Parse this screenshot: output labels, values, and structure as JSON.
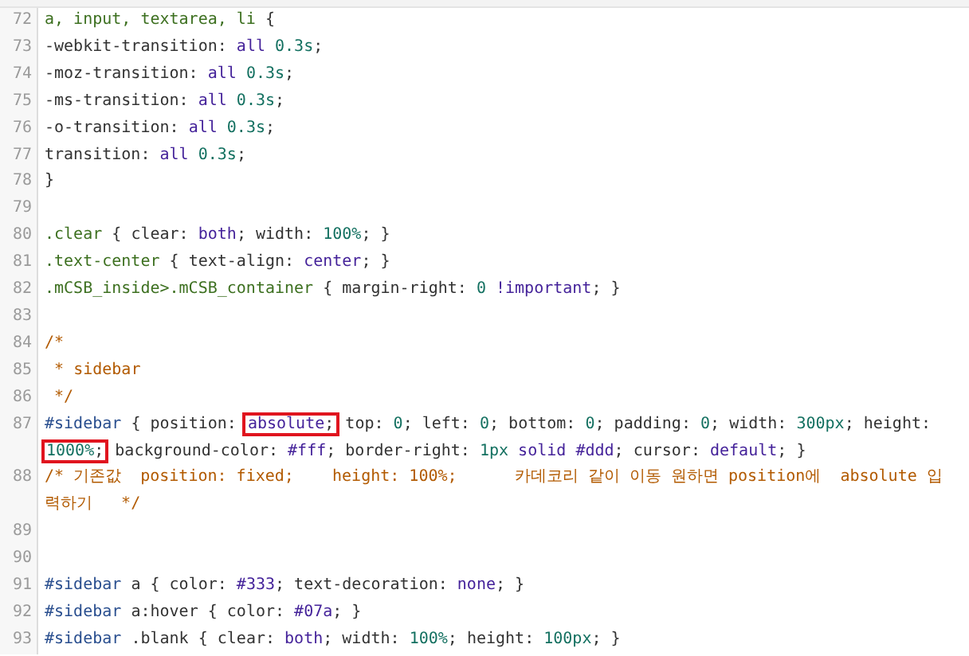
{
  "editor": {
    "lines": [
      {
        "number": "72",
        "rows": [
          [
            {
              "text": "a, input, textarea, li {",
              "boxed": false
            }
          ]
        ]
      },
      {
        "number": "73",
        "rows": [
          [
            {
              "text": "-webkit-transition: all 0.3s;",
              "boxed": false
            }
          ]
        ]
      },
      {
        "number": "74",
        "rows": [
          [
            {
              "text": "-moz-transition: all 0.3s;",
              "boxed": false
            }
          ]
        ]
      },
      {
        "number": "75",
        "rows": [
          [
            {
              "text": "-ms-transition: all 0.3s;",
              "boxed": false
            }
          ]
        ]
      },
      {
        "number": "76",
        "rows": [
          [
            {
              "text": "-o-transition: all 0.3s;",
              "boxed": false
            }
          ]
        ]
      },
      {
        "number": "77",
        "rows": [
          [
            {
              "text": "transition: all 0.3s;",
              "boxed": false
            }
          ]
        ]
      },
      {
        "number": "78",
        "rows": [
          [
            {
              "text": "}",
              "boxed": false
            }
          ]
        ]
      },
      {
        "number": "79",
        "rows": [
          []
        ]
      },
      {
        "number": "80",
        "rows": [
          [
            {
              "text": ".clear { clear: both; width: 100%; }",
              "boxed": false
            }
          ]
        ]
      },
      {
        "number": "81",
        "rows": [
          [
            {
              "text": ".text-center { text-align: center; }",
              "boxed": false
            }
          ]
        ]
      },
      {
        "number": "82",
        "rows": [
          [
            {
              "text": ".mCSB_inside>.mCSB_container { margin-right: 0 !important; }",
              "boxed": false
            }
          ]
        ]
      },
      {
        "number": "83",
        "rows": [
          []
        ]
      },
      {
        "number": "84",
        "rows": [
          [
            {
              "text": "/*",
              "boxed": false
            }
          ]
        ]
      },
      {
        "number": "85",
        "rows": [
          [
            {
              "text": " * sidebar",
              "boxed": false
            }
          ]
        ]
      },
      {
        "number": "86",
        "rows": [
          [
            {
              "text": " */",
              "boxed": false
            }
          ]
        ]
      },
      {
        "number": "87",
        "rows": [
          [
            {
              "text": "#sidebar { position: ",
              "boxed": false
            },
            {
              "text": "absolute;",
              "boxed": true
            },
            {
              "text": " top: 0; left: 0; bottom: 0; padding: 0; width: 300px; height:",
              "boxed": false
            }
          ],
          [
            {
              "text": "1000%;",
              "boxed": true
            },
            {
              "text": " background-color: #fff; border-right: 1px solid #ddd; cursor: default; }",
              "boxed": false
            }
          ]
        ]
      },
      {
        "number": "88",
        "rows": [
          [
            {
              "text": "/* 기존값  position: fixed;    height: 100%;      카데코리 같이 이동 원하면 position에  absolute 입",
              "boxed": false
            }
          ],
          [
            {
              "text": "력하기   */",
              "boxed": false
            }
          ]
        ]
      },
      {
        "number": "89",
        "rows": [
          []
        ]
      },
      {
        "number": "90",
        "rows": [
          []
        ]
      },
      {
        "number": "91",
        "rows": [
          [
            {
              "text": "#sidebar a { color: #333; text-decoration: none; }",
              "boxed": false
            }
          ]
        ]
      },
      {
        "number": "92",
        "rows": [
          [
            {
              "text": "#sidebar a:hover { color: #07a; }",
              "boxed": false
            }
          ]
        ]
      },
      {
        "number": "93",
        "rows": [
          [
            {
              "text": "#sidebar .blank { clear: both; width: 100%; height: 100px; }",
              "boxed": false
            }
          ]
        ]
      }
    ]
  }
}
